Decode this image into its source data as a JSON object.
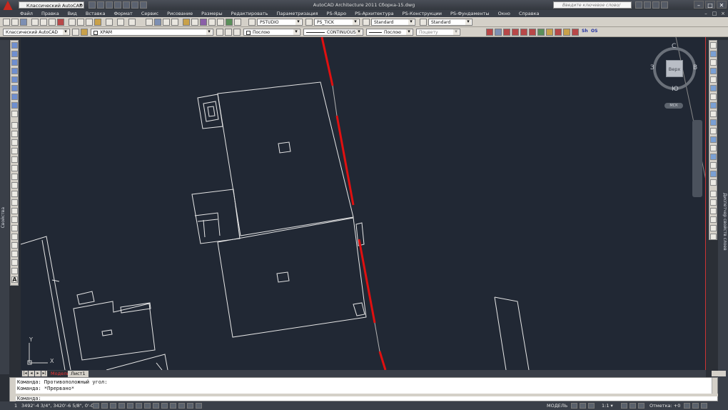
{
  "titlebar": {
    "workspace": "Классический AutoCAD",
    "title": "AutoCAD Architecture 2011   Сборка-15.dwg",
    "search_placeholder": "Введите ключевое слово/фразу",
    "minimize": "–",
    "restore": "□",
    "close": "✕"
  },
  "menu": [
    "Файл",
    "Правка",
    "Вид",
    "Вставка",
    "Формат",
    "Сервис",
    "Рисование",
    "Размеры",
    "Редактировать",
    "Параметризация",
    "PS-Ядро",
    "PS-Архитектура",
    "PS-Конструкции",
    "PS-Фундаменты",
    "Окно",
    "Справка"
  ],
  "toolbar1": {
    "text_style": "PSTUDIO",
    "dim_style": "PS_TICK",
    "table_style": "Standard",
    "mleader_style": "Standard"
  },
  "toolbar2": {
    "workspace": "Классический AutoCAD",
    "layer": "ХРАМ",
    "color": "Послою",
    "linetype": "CONTINUOUS",
    "lineweight": "Послою",
    "plotstyle": "Поцвету",
    "tb_text_1": "Sh",
    "tb_text_2": "OS"
  },
  "left_palette_label": "Свойства",
  "right_palette_label": "Диспетчер свойств слоев",
  "viewcube": {
    "face": "Верх",
    "north": "С",
    "south": "Ю",
    "west": "З",
    "east": "В",
    "wcs": "МСК"
  },
  "ucs": {
    "x": "X",
    "y": "Y"
  },
  "tabs": [
    "Модель",
    "Лист1"
  ],
  "command": {
    "line1": "Команда: Противоположный угол:",
    "line2": "Команда: *Прервано*",
    "prompt": "Команда:"
  },
  "status": {
    "number": "1",
    "coords": "3492'-4 3/4\", 3420'-6 5/8\", 0'-0\"",
    "model": "МОДЕЛЬ",
    "scale": "1:1 ▾",
    "mark": "Отметка: +0"
  },
  "colors": {
    "canvas": "#212834",
    "lines": "#e6e6e6",
    "red_line": "#e01010"
  }
}
